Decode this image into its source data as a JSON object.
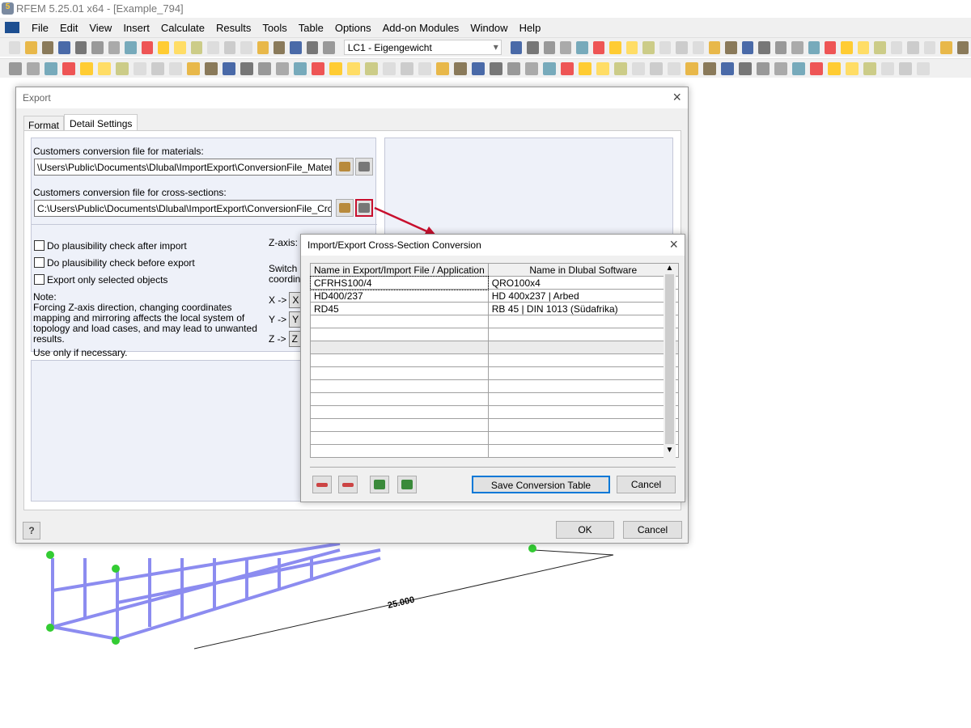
{
  "app": {
    "title": "RFEM 5.25.01 x64 - [Example_794]"
  },
  "menu": [
    "File",
    "Edit",
    "View",
    "Insert",
    "Calculate",
    "Results",
    "Tools",
    "Table",
    "Options",
    "Add-on Modules",
    "Window",
    "Help"
  ],
  "toolbar": {
    "load_case": "LC1 - Eigengewicht"
  },
  "export_dialog": {
    "title": "Export",
    "tabs": [
      "Format",
      "Detail Settings"
    ],
    "active_tab": "Detail Settings",
    "materials_label": "Customers conversion file for materials:",
    "materials_path": "\\Users\\Public\\Documents\\Dlubal\\ImportExport\\ConversionFile_Material.txt",
    "sections_label": "Customers conversion file for cross-sections:",
    "sections_path": "C:\\Users\\Public\\Documents\\Dlubal\\ImportExport\\ConversionFile_CrossSect",
    "checkboxes": [
      {
        "label": "Do plausibility check after import",
        "checked": false
      },
      {
        "label": "Do plausibility check before export",
        "checked": false
      },
      {
        "label": "Export only selected objects",
        "checked": false
      }
    ],
    "note_title": "Note:",
    "note_text": "Forcing Z-axis direction, changing coordinates mapping and mirroring affects the local system of topology and load cases, and may lead to unwanted results.",
    "note_use": "Use only if necessary.",
    "z_axis_label": "Z-axis:",
    "switch_label": "Switch coordina",
    "mapping": [
      {
        "from": "X ->",
        "to": "X"
      },
      {
        "from": "Y ->",
        "to": "Y"
      },
      {
        "from": "Z ->",
        "to": "Z"
      }
    ],
    "ok": "OK",
    "cancel": "Cancel"
  },
  "conversion_dialog": {
    "title": "Import/Export Cross-Section Conversion",
    "columns": [
      "Name in Export/Import File / Application",
      "Name in Dlubal Software"
    ],
    "rows": [
      [
        "CFRHS100/4",
        "QRO100x4"
      ],
      [
        "HD400/237",
        "HD 400x237 | Arbed"
      ],
      [
        "RD45",
        "RB 45 | DIN 1013 (Südafrika)"
      ],
      [
        "",
        ""
      ],
      [
        "",
        ""
      ],
      [
        "",
        ""
      ],
      [
        "",
        ""
      ],
      [
        "",
        ""
      ],
      [
        "",
        ""
      ],
      [
        "",
        ""
      ],
      [
        "",
        ""
      ],
      [
        "",
        ""
      ],
      [
        "",
        ""
      ],
      [
        "",
        ""
      ]
    ],
    "save": "Save Conversion Table",
    "cancel": "Cancel"
  },
  "model": {
    "dimension": "25.000"
  },
  "colors": {
    "highlight": "#c8102e",
    "accent_button": "#0078d7",
    "model_members": "#8c8cf0"
  }
}
